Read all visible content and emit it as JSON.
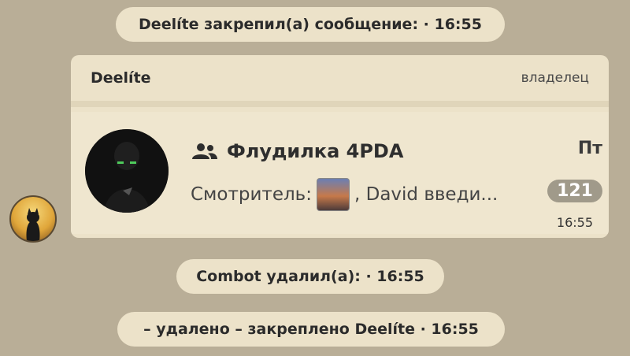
{
  "system_messages": {
    "pin_notice": "Deelíte закрепил(а) сообщение: · 16:55",
    "combot_notice": "Combot удалил(а): · 16:55",
    "deleted_notice": "– удалено – закреплено Deelíte  · 16:55"
  },
  "pinned_card": {
    "author": "Deelíte",
    "role": "владелец",
    "channel": {
      "title": "Флудилка 4PDA",
      "day": "Пт",
      "preview_prefix": "Смотритель:",
      "preview_suffix": ", David введи...",
      "unread_count": "121"
    },
    "time": "16:55"
  },
  "icons": {
    "group": "group-icon",
    "thumbnail": "photo-thumbnail",
    "user_avatar": "cat-avatar"
  },
  "colors": {
    "background": "#b9ae97",
    "bubble": "#ece2c9",
    "badge": "#a09a8a"
  }
}
